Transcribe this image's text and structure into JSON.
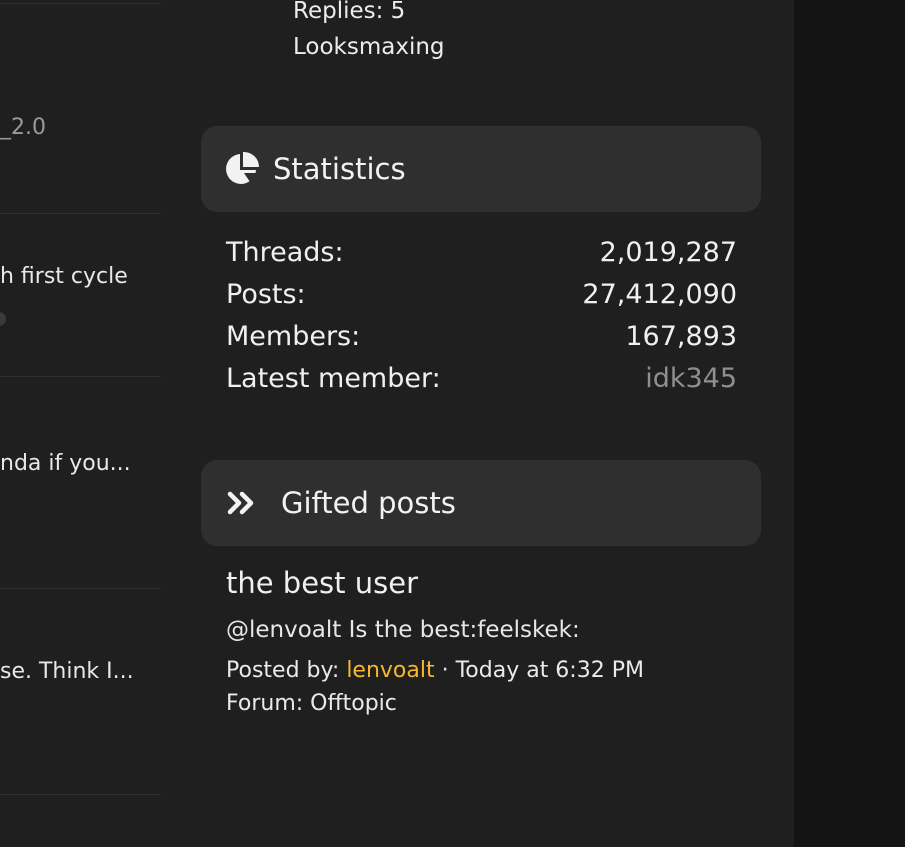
{
  "left_column": {
    "snippets": [
      {
        "text": "_2.0",
        "muted": true
      },
      {
        "text": "h first cycle",
        "muted": false
      },
      {
        "text": "nda if you...",
        "muted": false
      },
      {
        "text": "se. Think I...",
        "muted": false
      }
    ]
  },
  "previous_item": {
    "replies": "Replies: 5",
    "forum": "Looksmaxing"
  },
  "statistics": {
    "title": "Statistics",
    "icon": "pie-chart-icon",
    "rows": [
      {
        "label": "Threads:",
        "value": "2,019,287"
      },
      {
        "label": "Posts:",
        "value": "27,412,090"
      },
      {
        "label": "Members:",
        "value": "167,893"
      },
      {
        "label": "Latest member:",
        "value": "idk345"
      }
    ]
  },
  "gifted_posts": {
    "title": "Gifted posts",
    "icon": "double-chevron-right-icon",
    "post": {
      "title": "the best user",
      "snippet": "@lenvoalt Is the best:feelskek:",
      "posted_by_label": "Posted by: ",
      "username": "lenvoalt",
      "time": " · Today at 6:32 PM",
      "forum": "Forum: Offtopic"
    }
  },
  "colors": {
    "background": "#1f1f1f",
    "panel_header": "#2f2f2f",
    "username_accent": "#f5b82e",
    "muted_text": "#8f8f8f"
  }
}
